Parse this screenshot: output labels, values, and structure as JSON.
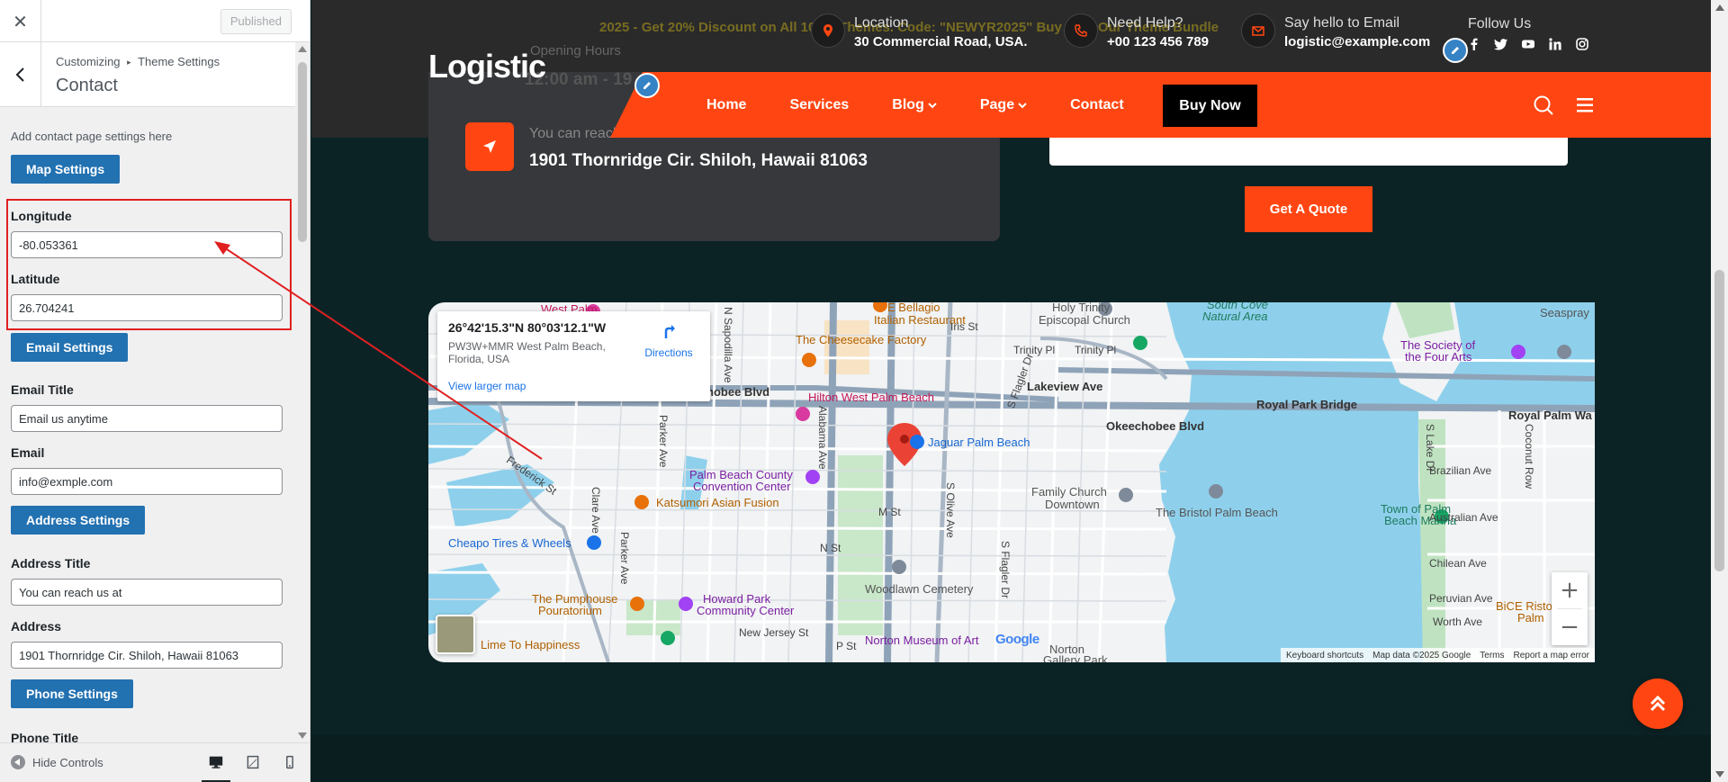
{
  "sidebar": {
    "close_icon": "close-icon",
    "published_label": "Published",
    "breadcrumb": {
      "root": "Customizing",
      "separator": "▸",
      "parent": "Theme Settings"
    },
    "title": "Contact",
    "description": "Add contact page settings here",
    "map_settings_label": "Map Settings",
    "longitude_label": "Longitude",
    "longitude_value": "-80.053361",
    "latitude_label": "Latitude",
    "latitude_value": "26.704241",
    "email_settings_label": "Email Settings",
    "email_title_label": "Email Title",
    "email_title_value": "Email us anytime",
    "email_label": "Email",
    "email_value": "info@exmple.com",
    "address_settings_label": "Address Settings",
    "address_title_label": "Address Title",
    "address_title_value": "You can reach us at",
    "address_label": "Address",
    "address_value": "1901 Thornridge Cir. Shiloh, Hawaii 81063",
    "phone_settings_label": "Phone Settings",
    "phone_title_label": "Phone Title",
    "hide_controls_label": "Hide Controls",
    "highlight_color": "#e02020",
    "accent": "#2271b1"
  },
  "preview": {
    "promo_text": "2025 - Get 20% Discount on All 100% Themes. Code: \"NEWYR2025\"   Buy Now  Our Theme Bundle",
    "opening_hours": "Opening Hours",
    "opening_time": "12:00 am - 19",
    "logo": "Logistic",
    "topbar": {
      "location_label": "Location",
      "location_value": "30 Commercial Road, USA.",
      "help_label": "Need Help?",
      "help_value": "+00 123 456 789",
      "email_label": "Say hello to Email",
      "email_value": "logistic@example.com",
      "follow_label": "Follow Us"
    },
    "nav": {
      "home": "Home",
      "services": "Services",
      "blog": "Blog",
      "page": "Page",
      "contact": "Contact",
      "buy_now": "Buy Now"
    },
    "card": {
      "subtitle": "You can reach us at",
      "address": "1901 Thornridge Cir. Shiloh, Hawaii 81063"
    },
    "quote_button": "Get A Quote",
    "brand_color": "#ff4612",
    "map": {
      "coords": "26°42'15.3\"N 80°03'12.1\"W",
      "plus_code": "PW3W+MMR West Palm Beach, Florida, USA",
      "directions": "Directions",
      "view_larger": "View larger map",
      "labels": {
        "west_palm": "West Palm",
        "bellagio": "E Bellagio",
        "italian": "Italian Restaurant",
        "holy_trinity": "Holy Trinity",
        "episcopal": "Episcopal Church",
        "iris": "Iris St",
        "south_cove": "South Cove",
        "natural_area": "Natural Area",
        "seaspray": "Seaspray",
        "cheesecake": "The Cheesecake Factory",
        "trinity1": "Trinity Pl",
        "trinity2": "Trinity Pl",
        "society1": "The Society of",
        "society2": "the Four Arts",
        "okeechobee": "Okeechobee Blvd",
        "okeechobee2": "Okeechobee Blvd",
        "hilton": "Hilton West Palm Beach",
        "lakeview": "Lakeview Ave",
        "royal_park": "Royal Park Bridge",
        "royal_palm": "Royal Palm Wa",
        "jaguar": "Jaguar Palm Beach",
        "pb_county1": "Palm Beach County",
        "pb_county2": "Convention Center",
        "brazilian": "Brazilian Ave",
        "katsumori": "Katsumori Asian Fusion",
        "family_church1": "Family Church",
        "family_church2": "Downtown",
        "bristol": "The Bristol Palm Beach",
        "town_palm1": "Town of Palm",
        "town_palm2": "Beach Marina",
        "australian": "Australian Ave",
        "m_st": "M St",
        "cheapo": "Cheapo Tires & Wheels",
        "n_st": "N St",
        "chilean": "Chilean Ave",
        "pumphouse1": "The Pumphouse",
        "pumphouse2": "Pouratorium",
        "howard1": "Howard Park",
        "howard2": "Community Center",
        "woodlawn": "Woodlawn Cemetery",
        "peruvian": "Peruvian Ave",
        "bice1": "BiCE Risto",
        "bice2": "Palm",
        "new_jersey": "New Jersey St",
        "p_st": "P St",
        "worth": "Worth Ave",
        "lime": "Lime To Happiness",
        "norton": "Norton Museum of Art",
        "norton2": "Norton",
        "norton3": "Gallery Park",
        "sapodilla": "N Sapodilla Ave",
        "parker": "Parker Ave",
        "parker2": "Parker Ave",
        "clare": "Clare Ave",
        "alabama": "Alabama Ave",
        "olive": "S Olive Ave",
        "flagler": "S Flagler Dr",
        "flagler2": "S Flagler Dr",
        "frederick": "Frederick St",
        "s_lake": "S Lake Dr",
        "coconut": "Coconut Row",
        "google": "Google"
      },
      "footer": {
        "shortcuts": "Keyboard shortcuts",
        "data": "Map data ©2025 Google",
        "terms": "Terms",
        "report": "Report a map error"
      }
    }
  }
}
